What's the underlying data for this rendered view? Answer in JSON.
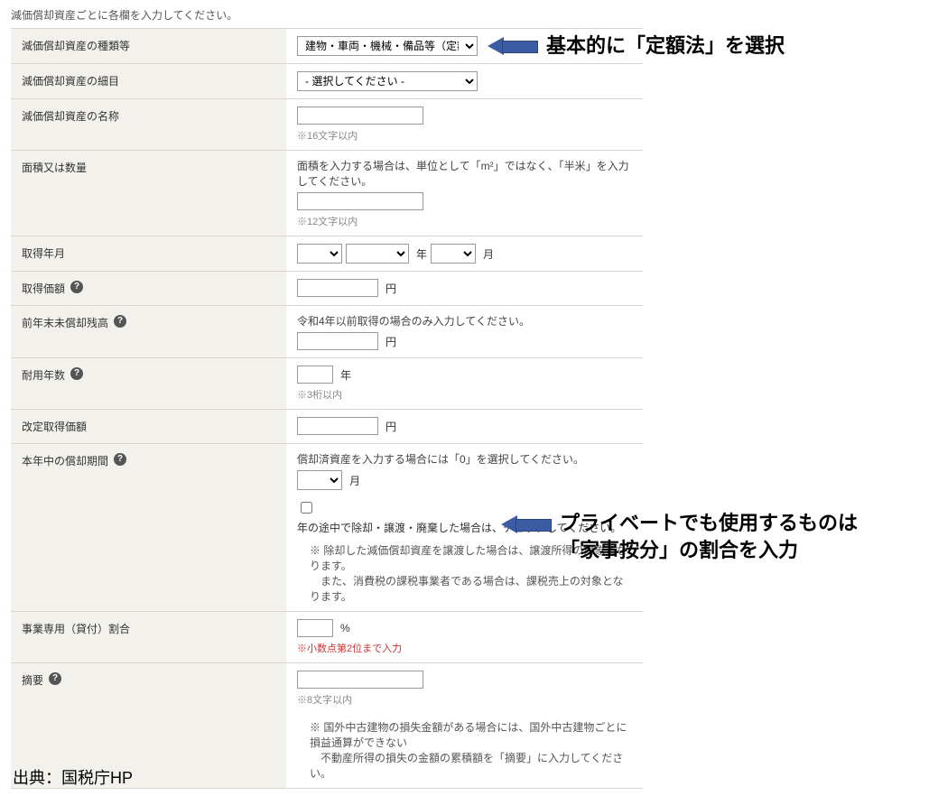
{
  "intro": "減価償却資産ごとに各欄を入力してください。",
  "rows": {
    "type": {
      "label": "減価償却資産の種類等",
      "value": "建物・車両・機械・備品等（定額法）"
    },
    "detail": {
      "label": "減価償却資産の細目",
      "placeholder": "- 選択してください -"
    },
    "name": {
      "label": "減価償却資産の名称",
      "hint": "※16文字以内"
    },
    "area": {
      "label": "面積又は数量",
      "desc": "面積を入力する場合は、単位として「m²」ではなく、「半米」を入力してください。",
      "hint": "※12文字以内"
    },
    "acq_date": {
      "label": "取得年月",
      "year_unit": "年",
      "month_unit": "月"
    },
    "acq_price": {
      "label": "取得価額",
      "unit": "円"
    },
    "prev_balance": {
      "label": "前年末未償却残高",
      "desc": "令和4年以前取得の場合のみ入力してください。",
      "unit": "円"
    },
    "useful_life": {
      "label": "耐用年数",
      "unit": "年",
      "hint": "※3桁以内"
    },
    "revised_price": {
      "label": "改定取得価額",
      "unit": "円"
    },
    "dep_period": {
      "label": "本年中の償却期間",
      "desc": "償却済資産を入力する場合には「0」を選択してください。",
      "unit": "月",
      "check_label": "年の途中で除却・譲渡・廃棄した場合は、チェックしてください。",
      "note": "※ 除却した減価償却資産を譲渡した場合は、譲渡所得の対象となります。\n　また、消費税の課税事業者である場合は、課税売上の対象となります。"
    },
    "business_ratio": {
      "label": "事業専用（貸付）割合",
      "unit": "%",
      "hint": "※小数点第2位まで入力"
    },
    "remarks": {
      "label": "摘要",
      "hint": "※8文字以内"
    }
  },
  "footer_note": "※ 国外中古建物の損失金額がある場合には、国外中古建物ごとに損益通算ができない\n　不動産所得の損失の金額の累積額を「摘要」に入力してください。",
  "annotations": {
    "a1": "基本的に「定額法」を選択",
    "a2_line1": "プライベートでも使用するものは",
    "a2_line2": "「家事按分」の割合を入力"
  },
  "source": "出典：国税庁HP"
}
